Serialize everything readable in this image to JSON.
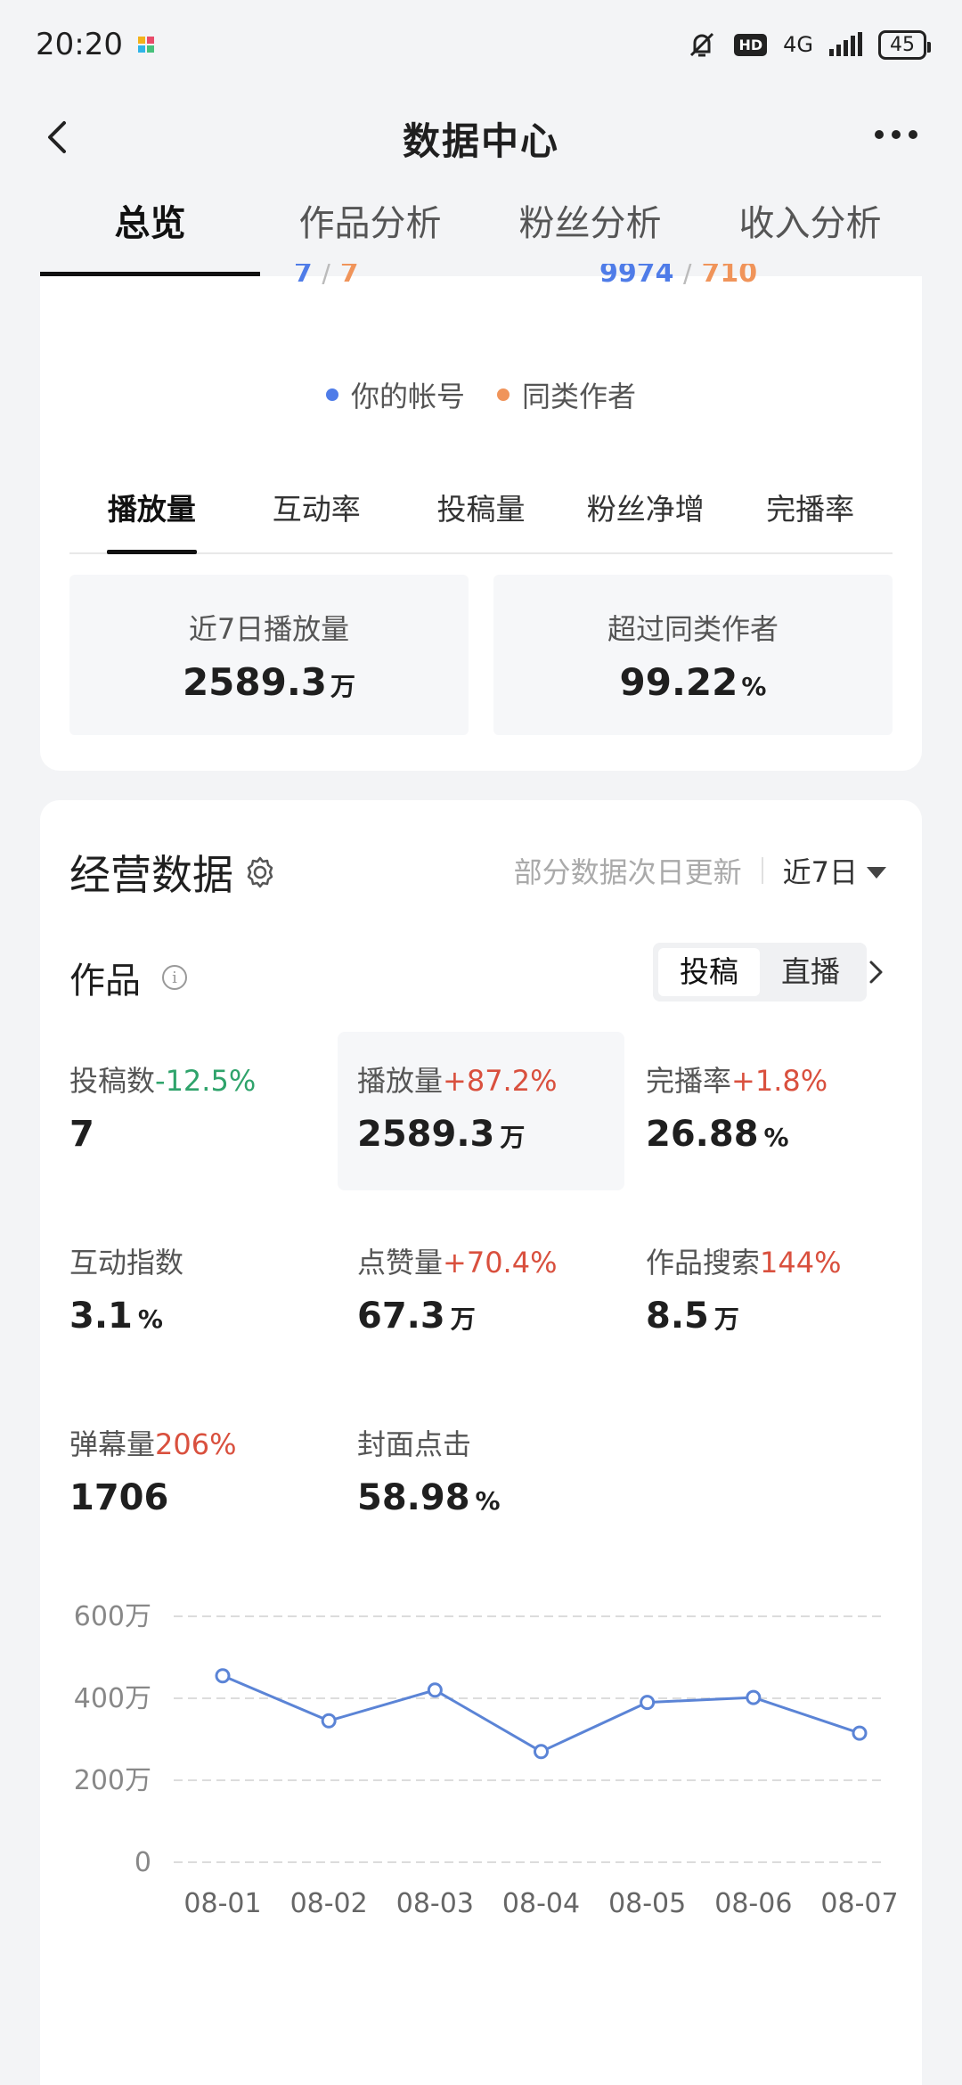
{
  "status": {
    "time": "20:20",
    "network": "4G",
    "hd": "HD",
    "battery": "45"
  },
  "header": {
    "title": "数据中心"
  },
  "top_tabs": [
    "总览",
    "作品分析",
    "粉丝分析",
    "收入分析"
  ],
  "overview": {
    "peek_left_a": "7",
    "peek_left_sep": "/",
    "peek_left_b": "7",
    "peek_right_a": "9974",
    "peek_right_sep": "/",
    "peek_right_b": "710",
    "legend": [
      {
        "label": "你的帐号",
        "color": "#4f7ce8"
      },
      {
        "label": "同类作者",
        "color": "#f0945a"
      }
    ],
    "sub_tabs": [
      "播放量",
      "互动率",
      "投稿量",
      "粉丝净增",
      "完播率"
    ],
    "stat_left": {
      "label": "近7日播放量",
      "value": "2589.3",
      "unit": "万"
    },
    "stat_right": {
      "label": "超过同类作者",
      "value": "99.22",
      "unit": "%"
    }
  },
  "business": {
    "title": "经营数据",
    "note": "部分数据次日更新",
    "period": "近7日",
    "works_title": "作品",
    "segment": [
      "投稿",
      "直播"
    ],
    "metrics": [
      {
        "label": "投稿数",
        "change": "-12.5%",
        "dir": "down",
        "value": "7",
        "unit": ""
      },
      {
        "label": "播放量",
        "change": "+87.2%",
        "dir": "up",
        "value": "2589.3",
        "unit": "万"
      },
      {
        "label": "完播率",
        "change": "+1.8%",
        "dir": "up",
        "value": "26.88",
        "unit": "%"
      },
      {
        "label": "互动指数",
        "change": "",
        "dir": "",
        "value": "3.1",
        "unit": "%"
      },
      {
        "label": "点赞量",
        "change": "+70.4%",
        "dir": "up",
        "value": "67.3",
        "unit": "万"
      },
      {
        "label": "作品搜索",
        "change": "144%",
        "dir": "up",
        "value": "8.5",
        "unit": "万"
      },
      {
        "label": "弹幕量",
        "change": "206%",
        "dir": "up",
        "value": "1706",
        "unit": ""
      },
      {
        "label": "封面点击",
        "change": "",
        "dir": "",
        "value": "58.98",
        "unit": "%"
      }
    ]
  },
  "chart_data": {
    "type": "line",
    "categories": [
      "08-01",
      "08-02",
      "08-03",
      "08-04",
      "08-05",
      "08-06",
      "08-07"
    ],
    "values": [
      455,
      345,
      420,
      270,
      390,
      402,
      315
    ],
    "ylim": [
      0,
      600
    ],
    "yticks": [
      {
        "value": 0,
        "label": "0"
      },
      {
        "value": 200,
        "label": "200万"
      },
      {
        "value": 400,
        "label": "400万"
      },
      {
        "value": 600,
        "label": "600万"
      }
    ],
    "line_color": "#5b84d6",
    "grid": true
  }
}
